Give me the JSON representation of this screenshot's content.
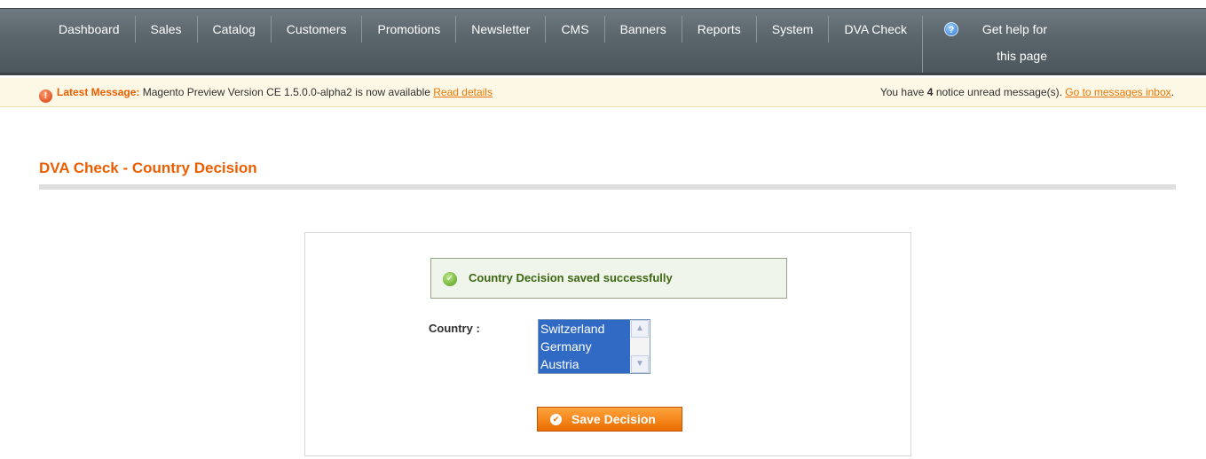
{
  "nav": {
    "items": [
      {
        "label": "Dashboard"
      },
      {
        "label": "Sales"
      },
      {
        "label": "Catalog"
      },
      {
        "label": "Customers"
      },
      {
        "label": "Promotions"
      },
      {
        "label": "Newsletter"
      },
      {
        "label": "CMS"
      },
      {
        "label": "Banners"
      },
      {
        "label": "Reports"
      },
      {
        "label": "System"
      },
      {
        "label": "DVA Check"
      }
    ],
    "help_line1": "Get help for",
    "help_line2": "this page",
    "help_icon": "question-circle-icon"
  },
  "message_bar": {
    "latest_label": "Latest Message:",
    "latest_text": "Magento Preview Version CE 1.5.0.0-alpha2 is now available",
    "read_details": "Read details",
    "notice_prefix": "You have",
    "notice_count": "4",
    "notice_suffix": "notice unread message(s).",
    "inbox_link": "Go to messages inbox",
    "inbox_suffix": ".",
    "icon": "critical-warning-icon"
  },
  "page": {
    "title": "DVA Check - Country Decision"
  },
  "form": {
    "success_message": "Country Decision saved successfully",
    "country_label": "Country :",
    "countries": [
      "Switzerland",
      "Germany",
      "Austria"
    ],
    "save_button": "Save Decision"
  },
  "colors": {
    "accent": "#eb5e00",
    "nav_bg": "#5a656b",
    "success_bg": "#eff5ea",
    "select_highlight": "#316ac5",
    "button": "#ea6d00"
  }
}
